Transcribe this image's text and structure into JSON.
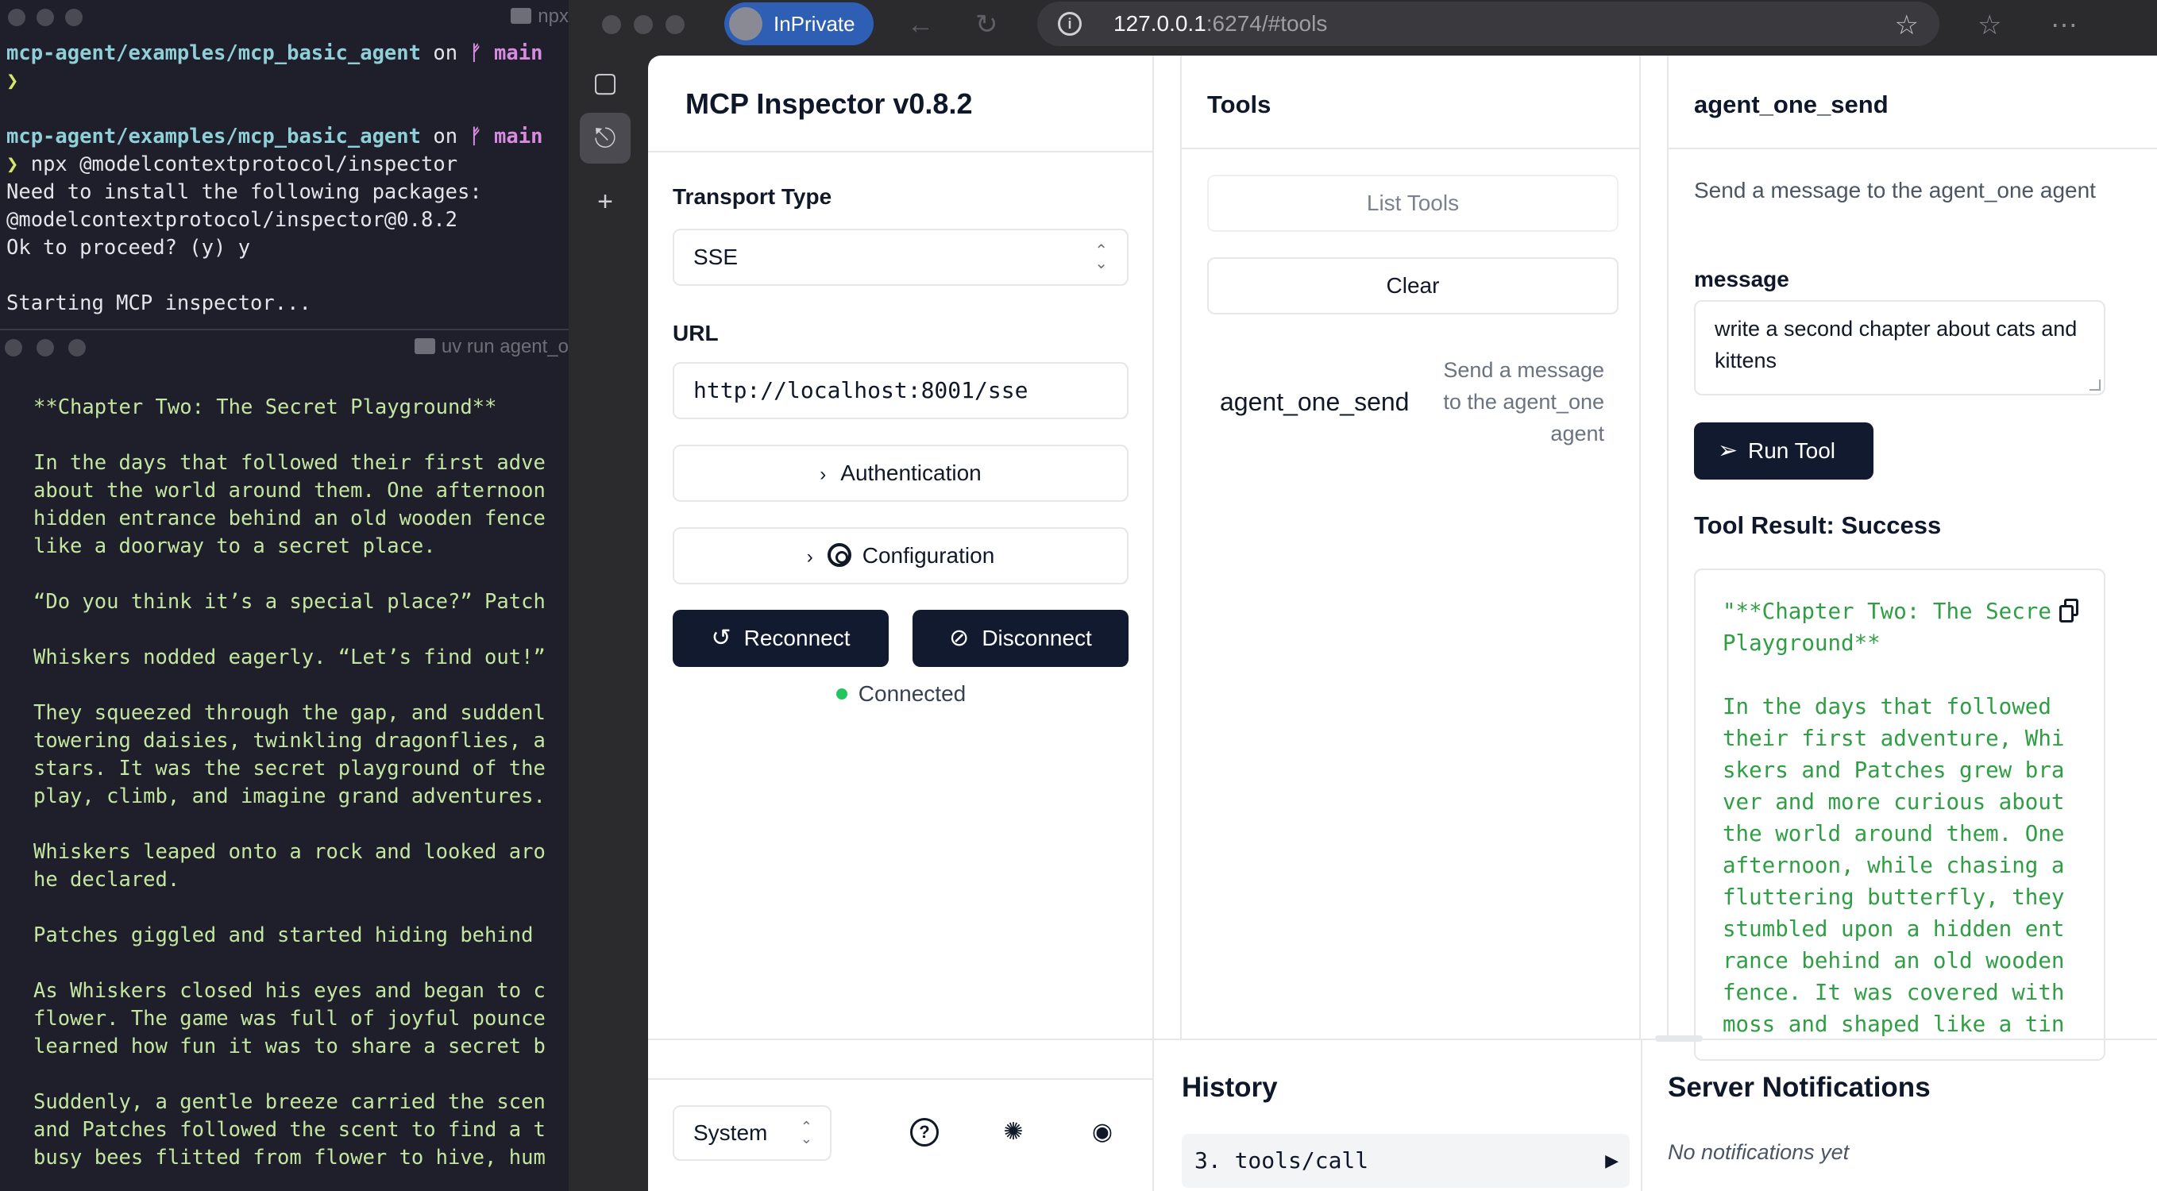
{
  "terminal_top": {
    "title": "npx",
    "lines": [
      {
        "path": "mcp-agent/examples/mcp_basic_agent",
        "on": " on ",
        "branch": "ᚠ main"
      },
      {
        "prompt": "❯"
      },
      {
        "blank": ""
      },
      {
        "path": "mcp-agent/examples/mcp_basic_agent",
        "on": " on ",
        "branch": "ᚠ main"
      },
      {
        "prompt": "❯",
        "cmd": " npx @modelcontextprotocol/inspector"
      },
      {
        "text": "Need to install the following packages:"
      },
      {
        "text": "@modelcontextprotocol/inspector@0.8.2"
      },
      {
        "text": "Ok to proceed? (y) y"
      },
      {
        "blank": ""
      },
      {
        "text": "Starting MCP inspector..."
      }
    ]
  },
  "terminal_bottom": {
    "title": "uv run agent_o",
    "story": "**Chapter Two: The Secret Playground**\n\nIn the days that followed their first adve\nabout the world around them. One afternoon\nhidden entrance behind an old wooden fence\nlike a doorway to a secret place.\n\n“Do you think it’s a special place?” Patch\n\nWhiskers nodded eagerly. “Let’s find out!”\n\nThey squeezed through the gap, and suddenl\ntowering daisies, twinkling dragonflies, a\nstars. It was the secret playground of the\nplay, climb, and imagine grand adventures.\n\nWhiskers leaped onto a rock and looked aro\nhe declared.\n\nPatches giggled and started hiding behind \n\nAs Whiskers closed his eyes and began to c\nflower. The game was full of joyful pounce\nlearned how fun it was to share a secret b\n\nSuddenly, a gentle breeze carried the scen\nand Patches followed the scent to find a t\nbusy bees flitted from flower to hive, hum"
  },
  "browser": {
    "inprivate_label": "InPrivate",
    "url_host": "127.0.0.1",
    "url_rest": ":6274/#tools"
  },
  "inspector": {
    "title": "MCP Inspector v0.8.2",
    "transport_label": "Transport Type",
    "transport_value": "SSE",
    "url_label": "URL",
    "url_value": "http://localhost:8001/sse",
    "auth_label": "Authentication",
    "config_label": "Configuration",
    "reconnect_label": "Reconnect",
    "disconnect_label": "Disconnect",
    "status_text": "Connected",
    "theme_value": "System"
  },
  "tools": {
    "title": "Tools",
    "list_label": "List Tools",
    "clear_label": "Clear",
    "items": [
      {
        "name": "agent_one_send",
        "description": "Send a message to the agent_one agent"
      }
    ]
  },
  "tool_detail": {
    "title": "agent_one_send",
    "description": "Send a message to the agent_one agent",
    "param_label": "message",
    "param_value": "write a second chapter about cats and kittens",
    "run_label": "Run Tool",
    "result_title": "Tool Result: Success",
    "result_text": "\"**Chapter Two: The Secre\nPlayground**\n\nIn the days that followed\ntheir first adventure, Whi\nskers and Patches grew bra\nver and more curious about\nthe world around them. One\nafternoon, while chasing a\nfluttering butterfly, they\nstumbled upon a hidden ent\nrance behind an old wooden\nfence. It was covered with\nmoss and shaped like a tin"
  },
  "history": {
    "title": "History",
    "items": [
      {
        "label": "3. tools/call"
      }
    ]
  },
  "notifications": {
    "title": "Server Notifications",
    "empty_text": "No notifications yet"
  }
}
